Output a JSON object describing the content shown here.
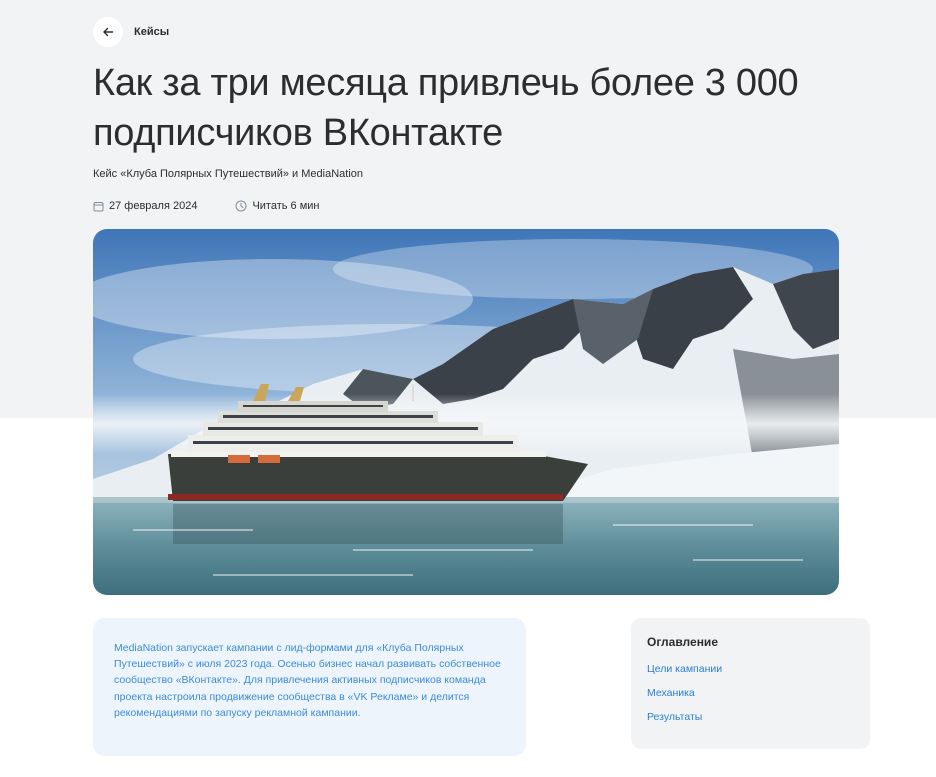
{
  "nav": {
    "back_label": "Кейсы"
  },
  "article": {
    "title": "Как за три месяца привлечь более 3 000 подписчиков ВКонтакте",
    "subtitle": "Кейс «Клуба Полярных Путешествий» и MediaNation",
    "date": "27 февраля 2024",
    "read_time": "Читать 6 мин",
    "lead": "MediaNation запускает кампании с лид-формами для «Клуба Полярных Путешествий» с июля 2023 года. Осенью бизнес начал развивать собственное сообщество «ВКонтакте». Для привлечения активных подписчиков команда проекта настроила продвижение сообщества в «VK Рекламе» и делится рекомендациями  по запуску рекламной кампании."
  },
  "toc": {
    "title": "Оглавление",
    "items": [
      "Цели кампании",
      "Механика",
      "Результаты"
    ]
  },
  "icons": {
    "back": "arrow-left-icon",
    "date": "calendar-icon",
    "read_time": "clock-icon"
  },
  "colors": {
    "page_band": "#f2f3f5",
    "text": "#2c2d2e",
    "lead_bg": "#eef4fc",
    "lead_text": "#3b8bd6",
    "link": "#2a7fd0"
  }
}
